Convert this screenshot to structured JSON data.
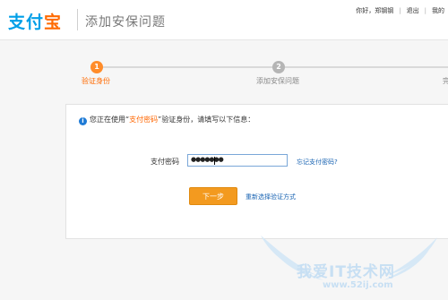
{
  "header": {
    "logo_prefix": "支付",
    "logo_suffix": "宝",
    "title": "添加安保问题",
    "greeting": "你好，郑钢钢",
    "logout": "退出",
    "my": "我的"
  },
  "steps": [
    {
      "number": "1",
      "label": "验证身份",
      "state": "active",
      "color": "#ff8c2a"
    },
    {
      "number": "2",
      "label": "添加安保问题",
      "state": "pending",
      "color": "#b5b5b5"
    },
    {
      "number": "3",
      "label": "完",
      "state": "pending",
      "color": "#b5b5b5"
    }
  ],
  "info": {
    "icon": "info-icon",
    "prefix": "您正在使用",
    "open_quote": "“",
    "highlight": "支付密码",
    "close_quote": "”",
    "suffix": "验证身份，请填写以下信息："
  },
  "form": {
    "password_label": "支付密码",
    "password_value": "●●●●●●●",
    "forgot_link": "忘记支付密码?",
    "next_button": "下一步",
    "reselect_link": "重新选择验证方式"
  },
  "watermark": {
    "text": "我爱IT技术网",
    "url": "www.52ij.com"
  }
}
